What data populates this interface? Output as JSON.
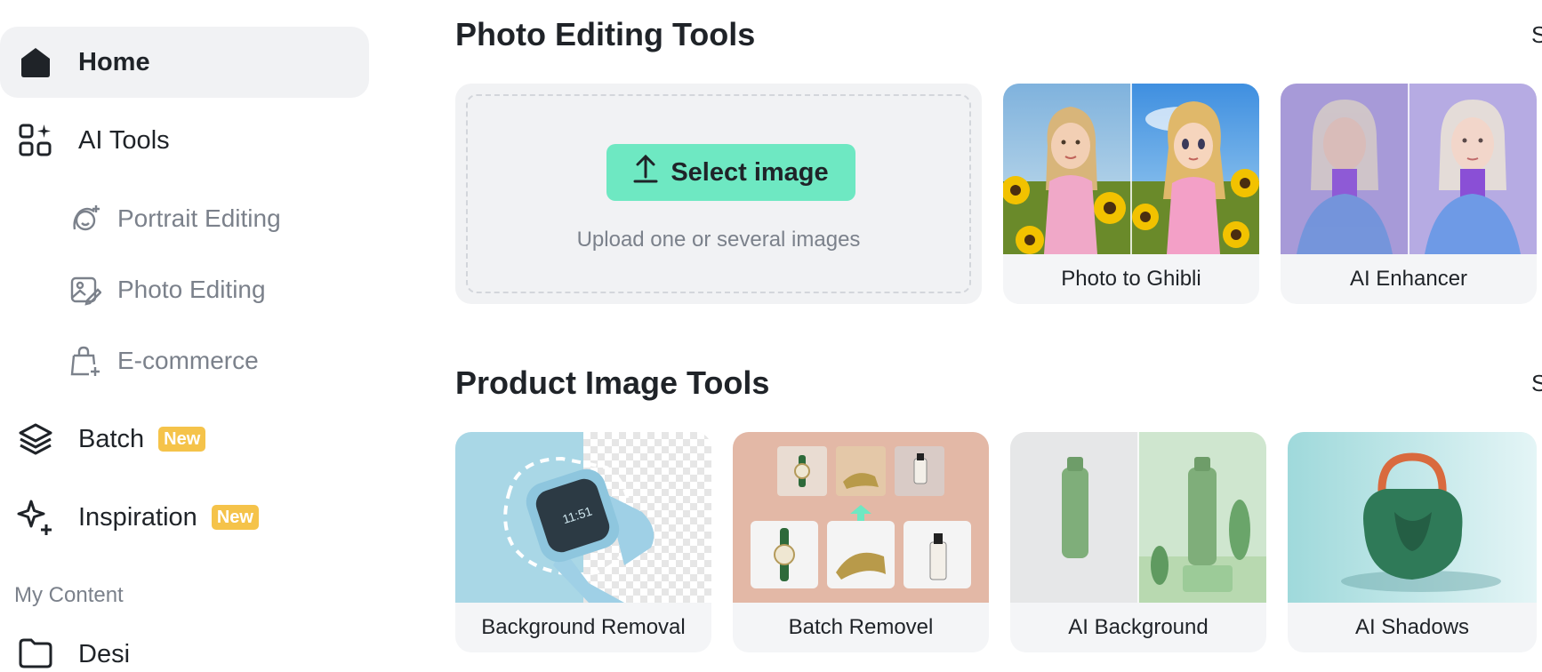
{
  "sidebar": {
    "items": [
      {
        "label": "Home",
        "icon": "home-icon"
      },
      {
        "label": "AI Tools",
        "icon": "ai-tools-grid-icon"
      },
      {
        "label": "Portrait Editing",
        "icon": "portrait-edit-icon"
      },
      {
        "label": "Photo Editing",
        "icon": "photo-edit-icon"
      },
      {
        "label": "E-commerce",
        "icon": "shopping-bag-icon"
      },
      {
        "label": "Batch",
        "icon": "layers-icon",
        "badge": "New"
      },
      {
        "label": "Inspiration",
        "icon": "sparkles-icon",
        "badge": "New"
      }
    ],
    "section_caption": "My Content",
    "folder_label": "Desi"
  },
  "photo_tools": {
    "title": "Photo Editing Tools",
    "see_all": "S",
    "upload": {
      "button_label": "Select image",
      "hint": "Upload one or several images"
    },
    "cards": [
      {
        "label": "Photo to Ghibli"
      },
      {
        "label": "AI Enhancer"
      }
    ]
  },
  "product_tools": {
    "title": "Product Image Tools",
    "see_all": "S",
    "cards": [
      {
        "label": "Background Removal"
      },
      {
        "label": "Batch Removel"
      },
      {
        "label": "AI Background"
      },
      {
        "label": "AI Shadows"
      }
    ]
  },
  "colors": {
    "accent": "#6ee8c2",
    "badge": "#f5c34a",
    "active_bg": "#f1f2f4",
    "muted_text": "#7b818b"
  }
}
